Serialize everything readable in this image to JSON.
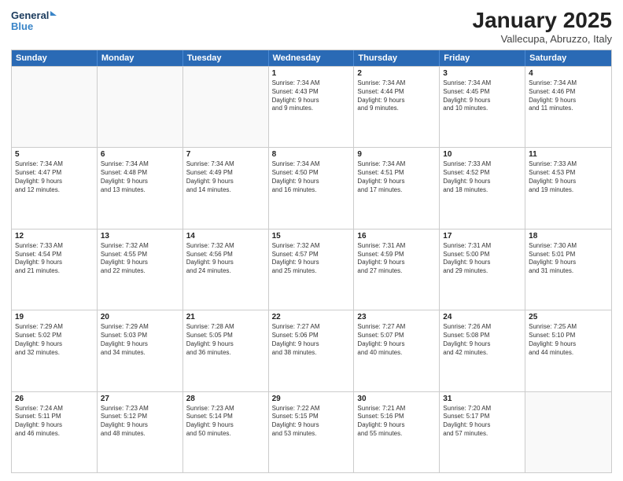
{
  "logo": {
    "line1": "General",
    "line2": "Blue"
  },
  "title": "January 2025",
  "location": "Vallecupa, Abruzzo, Italy",
  "days_of_week": [
    "Sunday",
    "Monday",
    "Tuesday",
    "Wednesday",
    "Thursday",
    "Friday",
    "Saturday"
  ],
  "rows": [
    [
      {
        "day": "",
        "info": ""
      },
      {
        "day": "",
        "info": ""
      },
      {
        "day": "",
        "info": ""
      },
      {
        "day": "1",
        "info": "Sunrise: 7:34 AM\nSunset: 4:43 PM\nDaylight: 9 hours\nand 9 minutes."
      },
      {
        "day": "2",
        "info": "Sunrise: 7:34 AM\nSunset: 4:44 PM\nDaylight: 9 hours\nand 9 minutes."
      },
      {
        "day": "3",
        "info": "Sunrise: 7:34 AM\nSunset: 4:45 PM\nDaylight: 9 hours\nand 10 minutes."
      },
      {
        "day": "4",
        "info": "Sunrise: 7:34 AM\nSunset: 4:46 PM\nDaylight: 9 hours\nand 11 minutes."
      }
    ],
    [
      {
        "day": "5",
        "info": "Sunrise: 7:34 AM\nSunset: 4:47 PM\nDaylight: 9 hours\nand 12 minutes."
      },
      {
        "day": "6",
        "info": "Sunrise: 7:34 AM\nSunset: 4:48 PM\nDaylight: 9 hours\nand 13 minutes."
      },
      {
        "day": "7",
        "info": "Sunrise: 7:34 AM\nSunset: 4:49 PM\nDaylight: 9 hours\nand 14 minutes."
      },
      {
        "day": "8",
        "info": "Sunrise: 7:34 AM\nSunset: 4:50 PM\nDaylight: 9 hours\nand 16 minutes."
      },
      {
        "day": "9",
        "info": "Sunrise: 7:34 AM\nSunset: 4:51 PM\nDaylight: 9 hours\nand 17 minutes."
      },
      {
        "day": "10",
        "info": "Sunrise: 7:33 AM\nSunset: 4:52 PM\nDaylight: 9 hours\nand 18 minutes."
      },
      {
        "day": "11",
        "info": "Sunrise: 7:33 AM\nSunset: 4:53 PM\nDaylight: 9 hours\nand 19 minutes."
      }
    ],
    [
      {
        "day": "12",
        "info": "Sunrise: 7:33 AM\nSunset: 4:54 PM\nDaylight: 9 hours\nand 21 minutes."
      },
      {
        "day": "13",
        "info": "Sunrise: 7:32 AM\nSunset: 4:55 PM\nDaylight: 9 hours\nand 22 minutes."
      },
      {
        "day": "14",
        "info": "Sunrise: 7:32 AM\nSunset: 4:56 PM\nDaylight: 9 hours\nand 24 minutes."
      },
      {
        "day": "15",
        "info": "Sunrise: 7:32 AM\nSunset: 4:57 PM\nDaylight: 9 hours\nand 25 minutes."
      },
      {
        "day": "16",
        "info": "Sunrise: 7:31 AM\nSunset: 4:59 PM\nDaylight: 9 hours\nand 27 minutes."
      },
      {
        "day": "17",
        "info": "Sunrise: 7:31 AM\nSunset: 5:00 PM\nDaylight: 9 hours\nand 29 minutes."
      },
      {
        "day": "18",
        "info": "Sunrise: 7:30 AM\nSunset: 5:01 PM\nDaylight: 9 hours\nand 31 minutes."
      }
    ],
    [
      {
        "day": "19",
        "info": "Sunrise: 7:29 AM\nSunset: 5:02 PM\nDaylight: 9 hours\nand 32 minutes."
      },
      {
        "day": "20",
        "info": "Sunrise: 7:29 AM\nSunset: 5:03 PM\nDaylight: 9 hours\nand 34 minutes."
      },
      {
        "day": "21",
        "info": "Sunrise: 7:28 AM\nSunset: 5:05 PM\nDaylight: 9 hours\nand 36 minutes."
      },
      {
        "day": "22",
        "info": "Sunrise: 7:27 AM\nSunset: 5:06 PM\nDaylight: 9 hours\nand 38 minutes."
      },
      {
        "day": "23",
        "info": "Sunrise: 7:27 AM\nSunset: 5:07 PM\nDaylight: 9 hours\nand 40 minutes."
      },
      {
        "day": "24",
        "info": "Sunrise: 7:26 AM\nSunset: 5:08 PM\nDaylight: 9 hours\nand 42 minutes."
      },
      {
        "day": "25",
        "info": "Sunrise: 7:25 AM\nSunset: 5:10 PM\nDaylight: 9 hours\nand 44 minutes."
      }
    ],
    [
      {
        "day": "26",
        "info": "Sunrise: 7:24 AM\nSunset: 5:11 PM\nDaylight: 9 hours\nand 46 minutes."
      },
      {
        "day": "27",
        "info": "Sunrise: 7:23 AM\nSunset: 5:12 PM\nDaylight: 9 hours\nand 48 minutes."
      },
      {
        "day": "28",
        "info": "Sunrise: 7:23 AM\nSunset: 5:14 PM\nDaylight: 9 hours\nand 50 minutes."
      },
      {
        "day": "29",
        "info": "Sunrise: 7:22 AM\nSunset: 5:15 PM\nDaylight: 9 hours\nand 53 minutes."
      },
      {
        "day": "30",
        "info": "Sunrise: 7:21 AM\nSunset: 5:16 PM\nDaylight: 9 hours\nand 55 minutes."
      },
      {
        "day": "31",
        "info": "Sunrise: 7:20 AM\nSunset: 5:17 PM\nDaylight: 9 hours\nand 57 minutes."
      },
      {
        "day": "",
        "info": ""
      }
    ]
  ]
}
